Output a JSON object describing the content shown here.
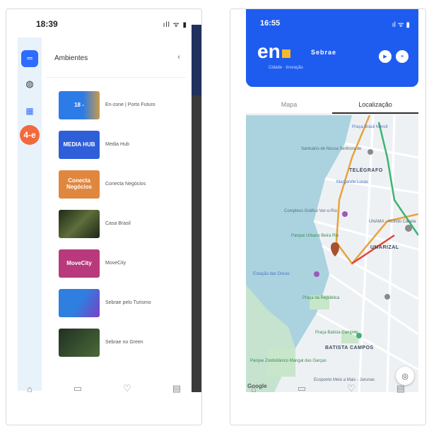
{
  "left": {
    "status": {
      "time": "18:39",
      "signal": "ıll ᯤ ▮"
    },
    "panel": {
      "title": "Ambientes",
      "close_icon": "‹"
    },
    "rail": {
      "logo": "4-e"
    },
    "items": [
      {
        "label": "En-zone | Porto Futuro",
        "thumb": "18 -",
        "color": "#2d7be6"
      },
      {
        "label": "Media Hub",
        "thumb": "MEDIA HUB",
        "color": "#2e5fd8"
      },
      {
        "label": "Conecta Negócios",
        "thumb": "Conecta Negócios",
        "color": "#e0873f"
      },
      {
        "label": "Casa Brasil",
        "thumb": "",
        "color": "#3f4a2e"
      },
      {
        "label": "MoveCity",
        "thumb": "MoveCity",
        "color": "#b83a7c"
      },
      {
        "label": "Sebrae pelo Turismo",
        "thumb": "",
        "color": "#2f7fe0"
      },
      {
        "label": "Sebrae no Green",
        "thumb": "",
        "color": "#324632"
      }
    ]
  },
  "right": {
    "status": {
      "time": "16:55",
      "signal": "ıl ᯤ ▮"
    },
    "brand": "en",
    "brand_sub": "Sebrae",
    "brand_tag": "Cidade · Inovação",
    "tabs": [
      "Mapa",
      "Localização"
    ],
    "map_labels": [
      "Praça Brasil Mercê",
      "Santuário de Nossa Senhora de",
      "TELÉGRAFO",
      "Margarete Lucas",
      "Complexo Gráfico Ver-o-Rio",
      "Parque Urbano Beira Rio",
      "UNAMA - Alcindo Cacela",
      "UMARIZAL",
      "Estação das Docas",
      "Praça da República",
      "Praça Batista Campos",
      "BATISTA CAMPOS",
      "Parque Zoobotânico Mangal das Garças",
      "Ecoponto Meio a Mais - Jurunas",
      "Google"
    ]
  }
}
